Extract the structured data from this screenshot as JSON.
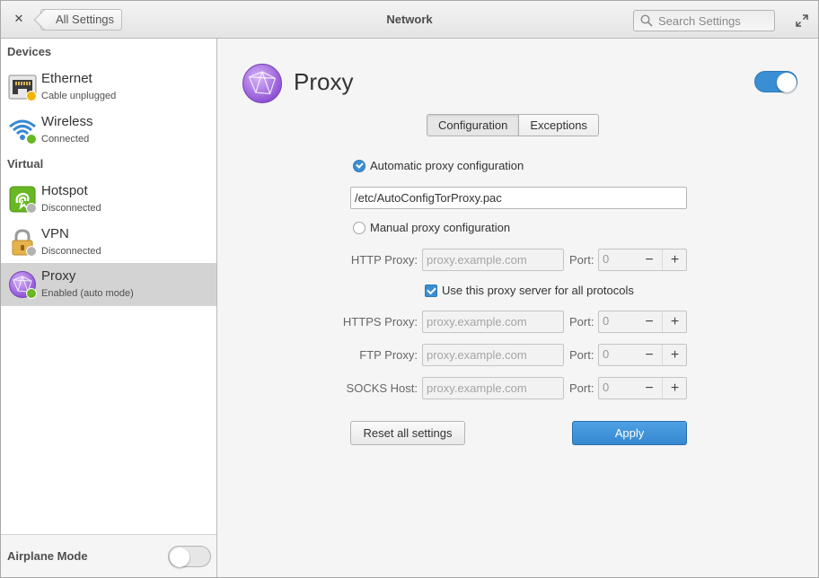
{
  "header": {
    "close_icon": "close-icon",
    "back_label": "All Settings",
    "title": "Network",
    "search_placeholder": "Search Settings",
    "maximize_icon": "maximize-icon"
  },
  "sidebar": {
    "devices_label": "Devices",
    "virtual_label": "Virtual",
    "items": [
      {
        "name": "Ethernet",
        "status": "Cable unplugged",
        "icon": "ethernet-icon",
        "status_color": "#f4b400"
      },
      {
        "name": "Wireless",
        "status": "Connected",
        "icon": "wifi-icon",
        "status_color": "#68b723"
      },
      {
        "name": "Hotspot",
        "status": "Disconnected",
        "icon": "hotspot-icon",
        "status_color": "#b3b3b3"
      },
      {
        "name": "VPN",
        "status": "Disconnected",
        "icon": "lock-icon",
        "status_color": "#b3b3b3"
      },
      {
        "name": "Proxy",
        "status": "Enabled (auto mode)",
        "icon": "globe-icon",
        "status_color": "#68b723",
        "selected": true
      }
    ],
    "airplane_label": "Airplane Mode",
    "airplane_on": false
  },
  "main": {
    "title": "Proxy",
    "enabled": true,
    "tabs": [
      {
        "label": "Configuration",
        "active": true
      },
      {
        "label": "Exceptions",
        "active": false
      }
    ],
    "auto_label": "Automatic proxy configuration",
    "auto_selected": true,
    "auto_url": "/etc/AutoConfigTorProxy.pac",
    "manual_label": "Manual proxy configuration",
    "manual_selected": false,
    "port_label": "Port:",
    "host_placeholder": "proxy.example.com",
    "use_all_label": "Use this proxy server for all protocols",
    "use_all_checked": true,
    "proxies": [
      {
        "label": "HTTP Proxy:",
        "port": "0"
      },
      {
        "label": "HTTPS Proxy:",
        "port": "0"
      },
      {
        "label": "FTP Proxy:",
        "port": "0"
      },
      {
        "label": "SOCKS Host:",
        "port": "0"
      }
    ],
    "reset_label": "Reset all settings",
    "apply_label": "Apply"
  },
  "colors": {
    "accent": "#3a8fd4",
    "selected_row": "#d3d3d3",
    "proxy_icon": "#a56de2"
  }
}
